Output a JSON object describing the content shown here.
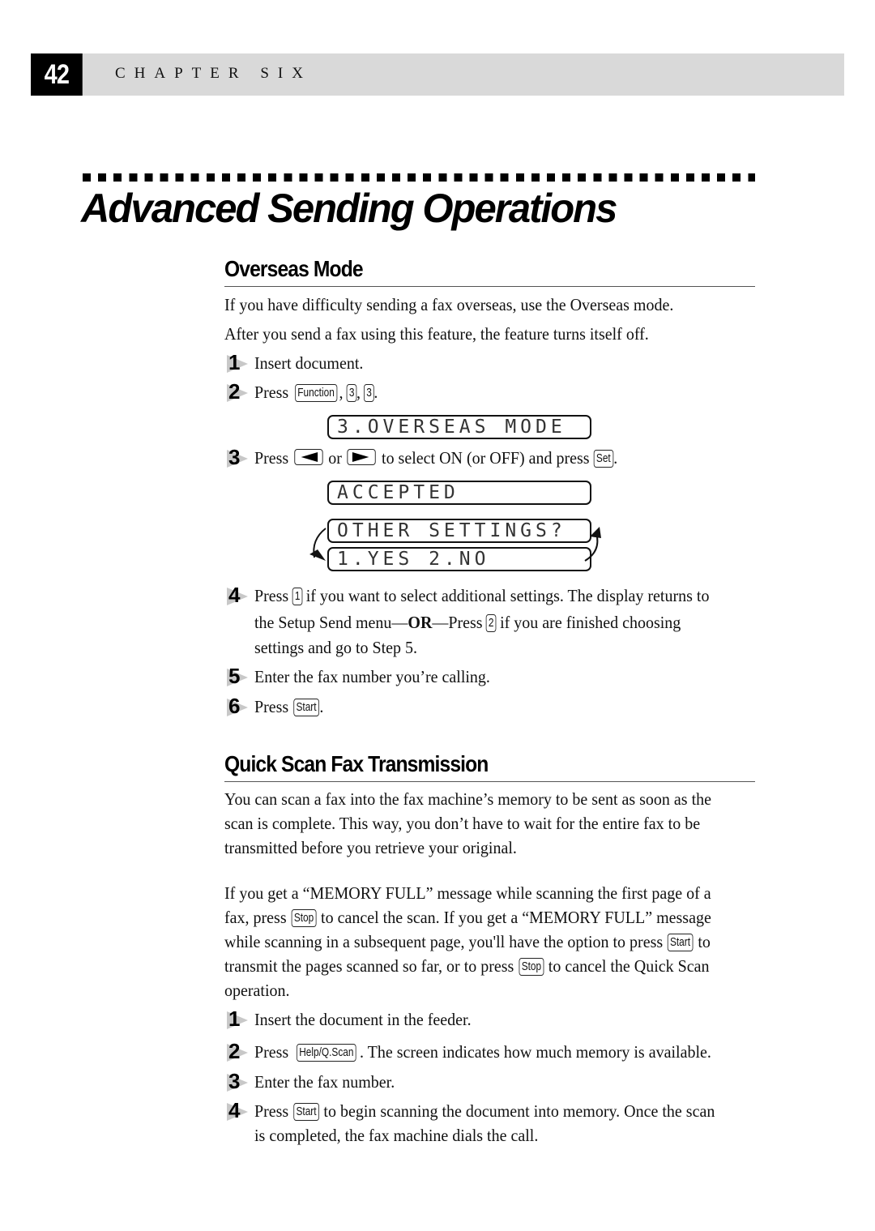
{
  "header": {
    "page_number": "42",
    "chapter": "CHAPTER SIX"
  },
  "title": "Advanced Sending Operations",
  "overseas": {
    "heading": "Overseas Mode",
    "intro1": "If you have difficulty sending a fax overseas, use the Overseas mode.",
    "intro2": "After you send a fax using this feature, the feature turns itself off.",
    "steps": [
      {
        "num": "1",
        "text": "Insert document."
      },
      {
        "num": "2",
        "pre": "Press",
        "keys": [
          "Function",
          "3",
          "3"
        ]
      },
      {
        "num": "3",
        "pre": "Press",
        "mid": "or",
        "post": "to select ON (or OFF) and press",
        "key_set": "Set"
      },
      {
        "num": "4",
        "pre": "Press",
        "key1": "1",
        "line1": "if you want to select additional settings. The display returns to",
        "line2_pre": "the Setup Send menu—",
        "or": "OR",
        "line2_mid": "—Press",
        "key2": "2",
        "line2_post": "if you are finished choosing",
        "line3": "settings and go to Step 5."
      },
      {
        "num": "5",
        "text": "Enter the fax number you’re calling."
      },
      {
        "num": "6",
        "pre": "Press",
        "key": "Start"
      }
    ],
    "lcd": {
      "screen1": "3.OVERSEAS MODE",
      "screen2": "ACCEPTED",
      "screen3a": "OTHER SETTINGS?",
      "screen3b": "1.YES 2.NO"
    }
  },
  "quickscan": {
    "heading": "Quick Scan Fax Transmission",
    "para1": [
      "You can scan a fax into the fax machine’s memory to be sent as soon as the",
      "scan is complete. This way, you don’t have to wait for the entire fax to be",
      "transmitted before you retrieve your original."
    ],
    "para2": {
      "l1": "If you get a “MEMORY FULL” message while scanning the first page of a",
      "l2_pre": "fax, press",
      "l2_key": "Stop",
      "l2_post": "to cancel the scan.  If you get a “MEMORY FULL” message",
      "l3_pre": "while scanning in a subsequent page, you'll have the option to press",
      "l3_key": "Start",
      "l3_post": "to",
      "l4_pre": "transmit the pages scanned so far, or to press",
      "l4_key": "Stop",
      "l4_post": "to cancel the Quick Scan",
      "l5": "operation."
    },
    "steps": [
      {
        "num": "1",
        "text": "Insert the document in the feeder."
      },
      {
        "num": "2",
        "pre": "Press",
        "key": "Help/Q.Scan",
        "post": ". The screen indicates how much memory is available."
      },
      {
        "num": "3",
        "text": "Enter the fax number."
      },
      {
        "num": "4",
        "pre": "Press",
        "key": "Start",
        "post": "to begin scanning the document into memory. Once the scan",
        "line2": "is completed, the fax machine dials the call."
      }
    ]
  }
}
